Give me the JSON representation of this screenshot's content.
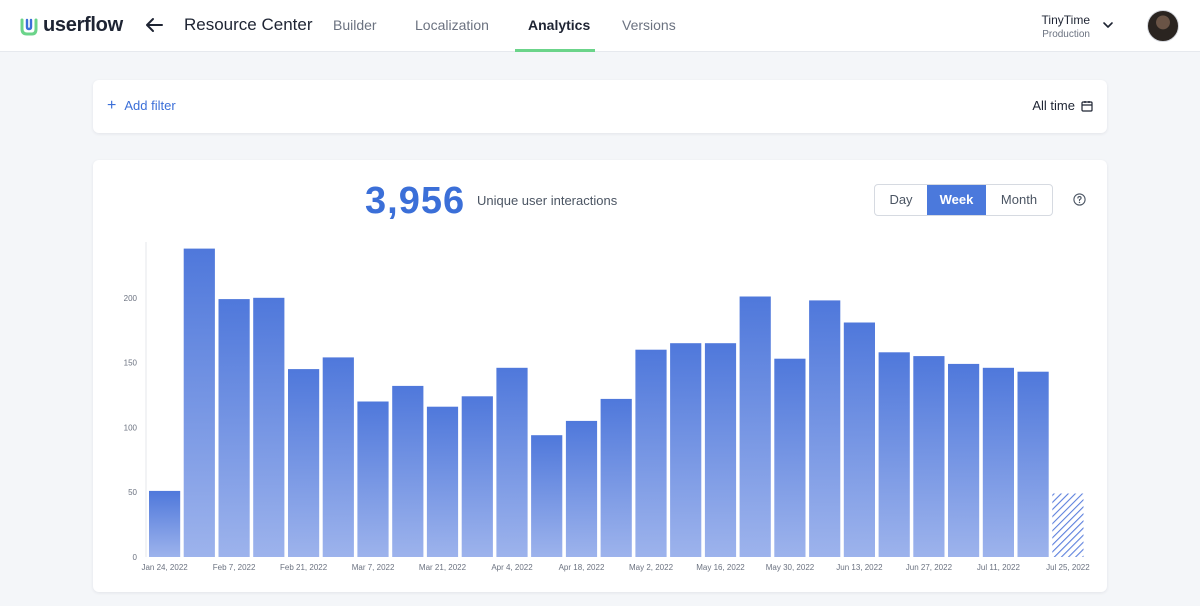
{
  "app": {
    "brand": "userflow",
    "page_title": "Resource Center"
  },
  "nav": {
    "tabs": [
      {
        "label": "Builder"
      },
      {
        "label": "Localization"
      },
      {
        "label": "Analytics",
        "active": true
      },
      {
        "label": "Versions"
      }
    ]
  },
  "org": {
    "name": "TinyTime",
    "environment": "Production"
  },
  "filters": {
    "add_label": "Add filter",
    "range_label": "All time"
  },
  "metric": {
    "value": "3,956",
    "label": "Unique user interactions"
  },
  "granularity": {
    "options": [
      "Day",
      "Week",
      "Month"
    ],
    "selected": "Week"
  },
  "colors": {
    "accent": "#3b6fd8",
    "active_tab_underline": "#6bd48a"
  },
  "chart_data": {
    "type": "bar",
    "categories": [
      "Jan 24, 2022",
      "Jan 31, 2022",
      "Feb 7, 2022",
      "Feb 14, 2022",
      "Feb 21, 2022",
      "Feb 28, 2022",
      "Mar 7, 2022",
      "Mar 14, 2022",
      "Mar 21, 2022",
      "Mar 28, 2022",
      "Apr 4, 2022",
      "Apr 11, 2022",
      "Apr 18, 2022",
      "Apr 25, 2022",
      "May 2, 2022",
      "May 9, 2022",
      "May 16, 2022",
      "May 23, 2022",
      "May 30, 2022",
      "Jun 6, 2022",
      "Jun 13, 2022",
      "Jun 20, 2022",
      "Jun 27, 2022",
      "Jul 4, 2022",
      "Jul 11, 2022",
      "Jul 18, 2022",
      "Jul 25, 2022"
    ],
    "x_tick_labels": [
      "Jan 24, 2022",
      "Feb 7, 2022",
      "Feb 21, 2022",
      "Mar 7, 2022",
      "Mar 21, 2022",
      "Apr 4, 2022",
      "Apr 18, 2022",
      "May 2, 2022",
      "May 16, 2022",
      "May 30, 2022",
      "Jun 13, 2022",
      "Jun 27, 2022",
      "Jul 11, 2022",
      "Jul 25, 2022"
    ],
    "values": [
      51,
      238,
      199,
      200,
      145,
      154,
      120,
      132,
      116,
      124,
      146,
      94,
      105,
      122,
      160,
      165,
      165,
      201,
      153,
      198,
      181,
      158,
      155,
      149,
      146,
      143,
      49
    ],
    "partial_last_period": true,
    "y_ticks": [
      0,
      50,
      100,
      150,
      200
    ],
    "ylim": [
      0,
      240
    ],
    "title": "",
    "xlabel": "",
    "ylabel": ""
  }
}
